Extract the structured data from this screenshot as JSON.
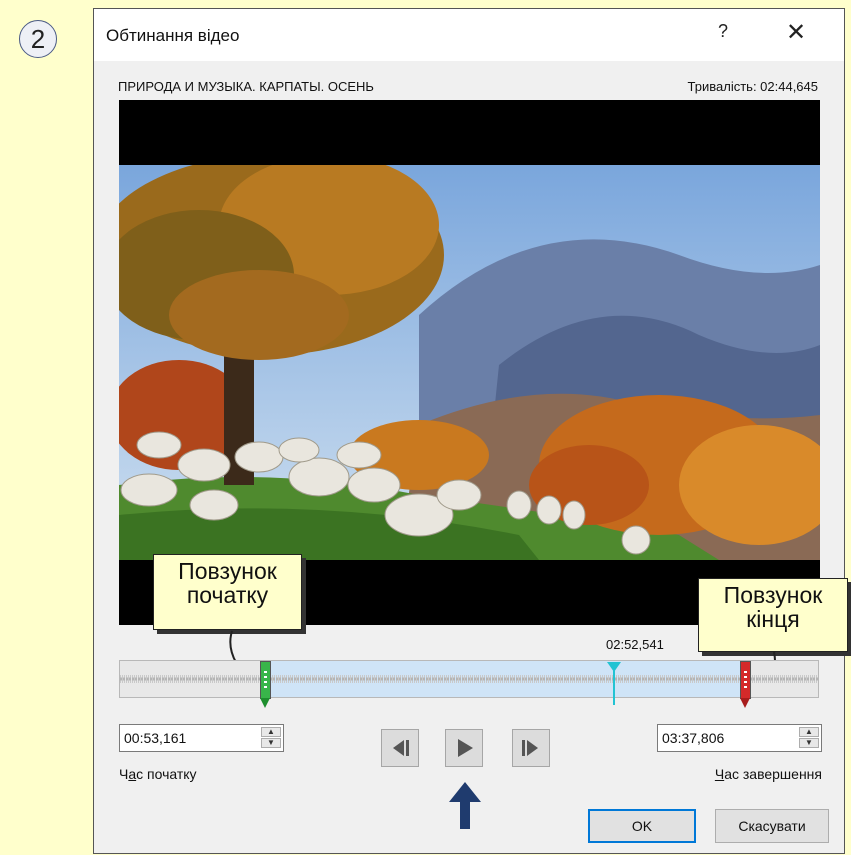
{
  "step_number": "2",
  "dialog": {
    "title": "Обтинання відео",
    "help_label": "?",
    "close_label": "✕",
    "video_name": "ПРИРОДА И МУЗЫКА. КАРПАТЫ. ОСЕНЬ",
    "duration_text": "Тривалість: 02:44,645"
  },
  "callouts": {
    "start_line1": "Повзунок",
    "start_line2": "початку",
    "end_line1": "Повзунок",
    "end_line2": "кінця"
  },
  "timeline": {
    "current_time": "02:52,541"
  },
  "start_time": {
    "value": "00:53,161",
    "label_pre": "Ч",
    "label_ul": "а",
    "label_post": "с початку"
  },
  "end_time": {
    "value": "03:37,806",
    "label_pre": "",
    "label_ul": "Ч",
    "label_post": "ас завершення"
  },
  "buttons": {
    "ok": "OK",
    "cancel": "Скасувати"
  },
  "icons": {
    "prev_frame": "previous-frame-icon",
    "play": "play-icon",
    "next_frame": "next-frame-icon",
    "pointer": "up-arrow-icon"
  },
  "colors": {
    "callout_bg": "#ffffcc",
    "start_handle": "#39b54a",
    "end_handle": "#d42a2a",
    "playhead": "#22c3d3",
    "selection": "#cfe4f7"
  }
}
